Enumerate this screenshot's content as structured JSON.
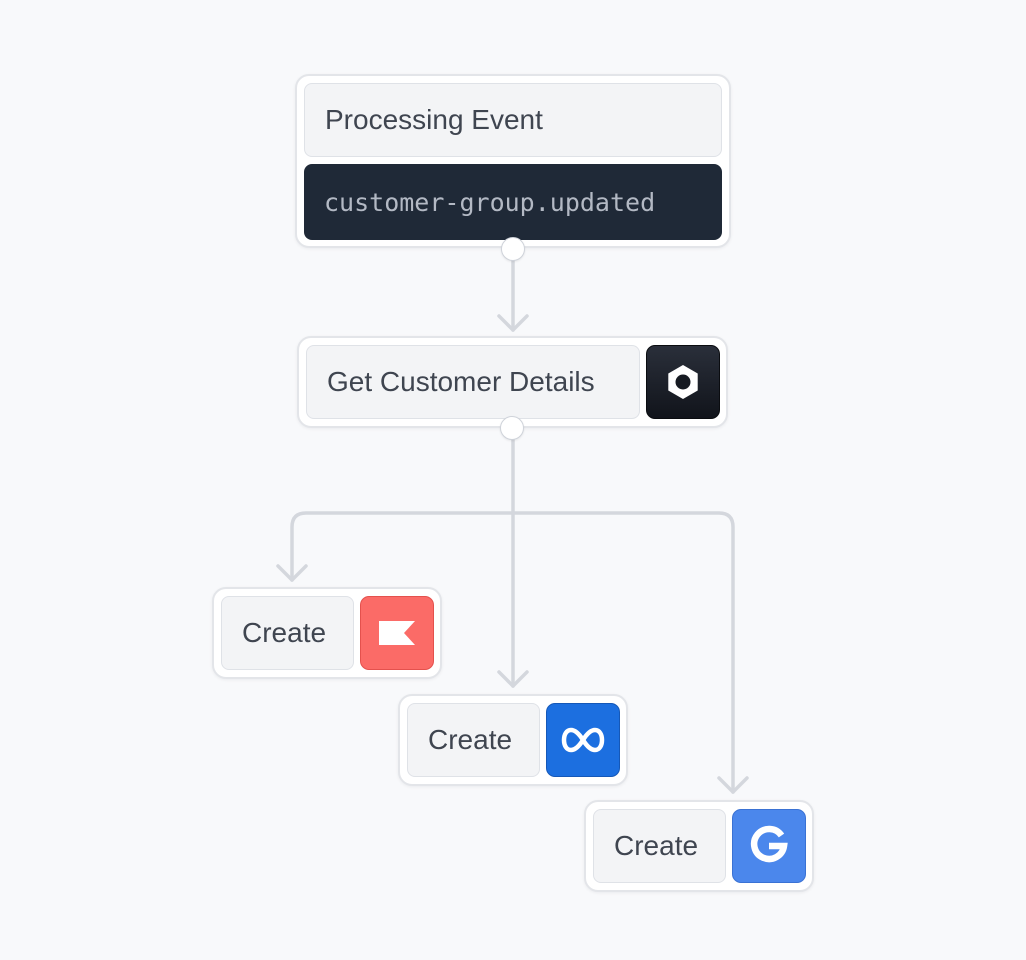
{
  "trigger": {
    "title": "Processing Event",
    "event_name": "customer-group.updated"
  },
  "step": {
    "label": "Get Customer Details",
    "icon": "hexagon-ring-icon"
  },
  "actions": [
    {
      "label": "Create",
      "icon": "flag-icon",
      "color": "#fb6b67"
    },
    {
      "label": "Create",
      "icon": "meta-infinity-icon",
      "color": "#1c6fe0"
    },
    {
      "label": "Create",
      "icon": "google-g-icon",
      "color": "#4b87ec"
    }
  ],
  "colors": {
    "background": "#f8f9fb",
    "connector": "#d4d7dd",
    "code_background": "#1f2937"
  }
}
